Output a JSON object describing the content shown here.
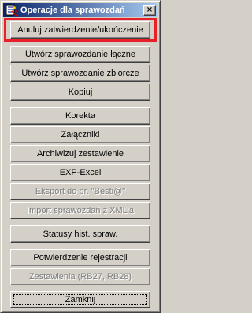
{
  "window": {
    "title": "Operacje dla sprawozdań",
    "close_glyph": "×"
  },
  "buttons": [
    {
      "label": "Anuluj zatwierdzenie/ukończenie",
      "enabled": true
    },
    {
      "label": "Utwórz sprawozdanie łączne",
      "enabled": true
    },
    {
      "label": "Utwórz sprawozdanie zbiorcze",
      "enabled": true
    },
    {
      "label": "Kopiuj",
      "enabled": true
    },
    {
      "label": "Korekta",
      "enabled": true
    },
    {
      "label": "Załączniki",
      "enabled": true
    },
    {
      "label": "Archiwizuj zestawienie",
      "enabled": true
    },
    {
      "label": "EXP-Excel",
      "enabled": true
    },
    {
      "label": "Eksport do pr. \"Besti@\"",
      "enabled": false
    },
    {
      "label": "Import sprawozdań z XML'a",
      "enabled": false
    },
    {
      "label": "Statusy hist. spraw.",
      "enabled": true
    },
    {
      "label": "Potwierdzenie rejestracji",
      "enabled": true
    },
    {
      "label": "Zestawienia (RB27, RB28)",
      "enabled": false
    },
    {
      "label": "Zamknij",
      "enabled": true
    }
  ],
  "colors": {
    "highlight": "#e8202a",
    "titlebar_start": "#0a246a",
    "titlebar_end": "#a6caf0",
    "face": "#d4d0c8"
  },
  "icons": {
    "app": "report-app-icon",
    "close": "close-icon"
  }
}
